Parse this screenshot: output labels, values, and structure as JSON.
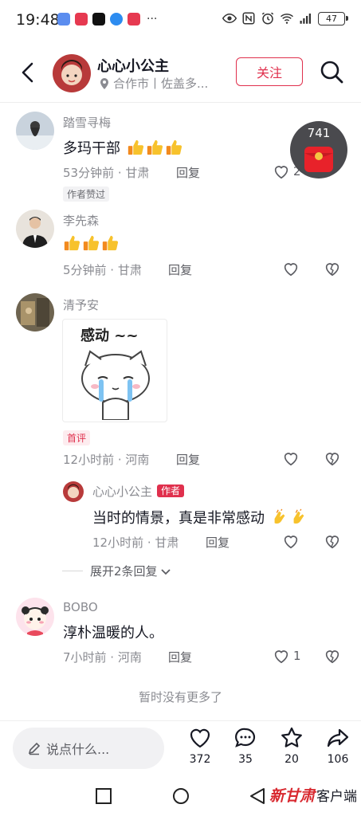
{
  "status_bar": {
    "time": "19:48",
    "battery": "47",
    "apps": [
      "app-icon-1",
      "app-icon-2",
      "tiktok-icon",
      "app-icon-4",
      "app-icon-5"
    ],
    "more": "···"
  },
  "header": {
    "name": "心心小公主",
    "location": "合作市丨佐盖多...",
    "follow_label": "关注"
  },
  "red_packet": {
    "count": "741"
  },
  "comments": [
    {
      "user": "踏雪寻梅",
      "text": "多玛干部",
      "time_loc": "53分钟前 · 甘肃",
      "reply": "回复",
      "likes": "2",
      "tag": "作者赞过"
    },
    {
      "user": "李先森",
      "text": "",
      "time_loc": "5分钟前 · 甘肃",
      "reply": "回复"
    },
    {
      "user": "清予安",
      "sticker_text": "感动 ~~",
      "tag": "首评",
      "time_loc": "12小时前 · 河南",
      "reply": "回复"
    },
    {
      "user": "BOBO",
      "text": "淳朴温暖的人。",
      "time_loc": "7小时前 · 河南",
      "reply": "回复",
      "likes": "1"
    }
  ],
  "author_reply": {
    "user": "心心小公主",
    "author_tag": "作者",
    "text": "当时的情景，真是非常感动",
    "time_loc": "12小时前 · 甘肃",
    "reply": "回复"
  },
  "expand_label": "展开2条回复",
  "no_more": "暂时没有更多了",
  "bottom_bar": {
    "placeholder": "说点什么...",
    "likes": "372",
    "comments": "35",
    "favorites": "20",
    "shares": "106"
  },
  "watermark": {
    "logo": "新甘肃",
    "label": "客户端"
  },
  "colors": {
    "accent": "#e0304d",
    "text": "#161823",
    "muted": "#8a8b91"
  }
}
